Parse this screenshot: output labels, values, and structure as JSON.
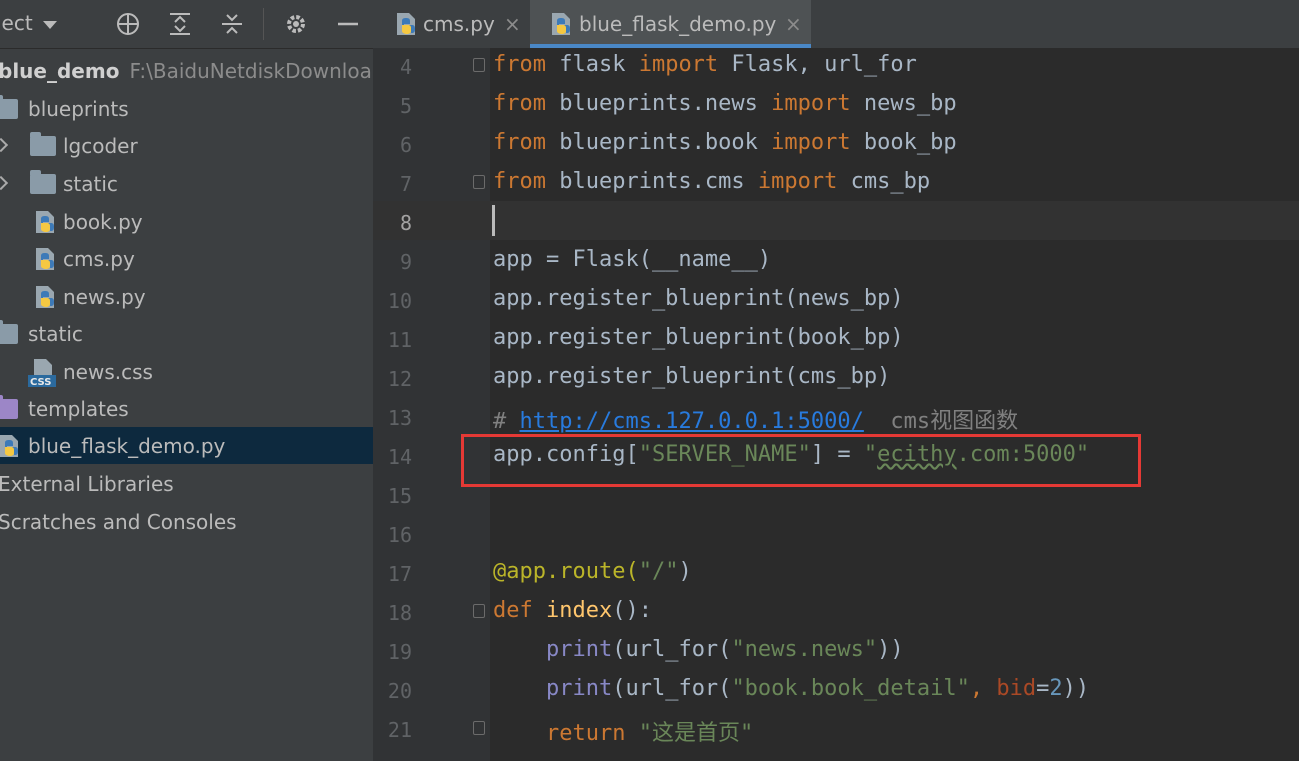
{
  "project_panel": {
    "title": "ject",
    "toolbar_icons": [
      "crosshair-icon",
      "expand-all-icon",
      "collapse-all-icon",
      "gear-icon",
      "minimize-icon"
    ],
    "tree": [
      {
        "label": "blue_demo",
        "path": "F:\\BaiduNetdiskDownloac",
        "type": "root"
      },
      {
        "label": "blueprints",
        "type": "folder"
      },
      {
        "label": "lgcoder",
        "type": "folder"
      },
      {
        "label": "static",
        "type": "folder"
      },
      {
        "label": "book.py",
        "type": "python"
      },
      {
        "label": "cms.py",
        "type": "python"
      },
      {
        "label": "news.py",
        "type": "python"
      },
      {
        "label": "static",
        "type": "folder"
      },
      {
        "label": "news.css",
        "type": "css"
      },
      {
        "label": "templates",
        "type": "folder-purple"
      },
      {
        "label": "blue_flask_demo.py",
        "type": "python",
        "selected": true
      },
      {
        "label": "External Libraries",
        "type": "library"
      },
      {
        "label": "Scratches and Consoles",
        "type": "scratch"
      }
    ],
    "css_badge": "CSS"
  },
  "tabs": [
    {
      "name": "cms.py",
      "close": "×",
      "active": false
    },
    {
      "name": "blue_flask_demo.py",
      "close": "×",
      "active": true
    }
  ],
  "editor": {
    "line_numbers": [
      "4",
      "5",
      "6",
      "7",
      "8",
      "9",
      "10",
      "11",
      "12",
      "13",
      "14",
      "15",
      "16",
      "17",
      "18",
      "19",
      "20",
      "21"
    ],
    "current_line": "8",
    "lines": {
      "l4": {
        "t1": "from",
        "t2": " flask ",
        "t3": "import",
        "t4": " Flask, url_for"
      },
      "l5": {
        "t1": "from",
        "t2": " blueprints.news ",
        "t3": "import",
        "t4": " news_bp"
      },
      "l6": {
        "t1": "from",
        "t2": " blueprints.book ",
        "t3": "import",
        "t4": " book_bp"
      },
      "l7": {
        "t1": "from",
        "t2": " blueprints.cms ",
        "t3": "import",
        "t4": " cms_bp"
      },
      "l9": {
        "t1": "app = Flask(__name__)"
      },
      "l10": {
        "t1": "app.register_blueprint(news_bp)"
      },
      "l11": {
        "t1": "app.register_blueprint(book_bp)"
      },
      "l12": {
        "t1": "app.register_blueprint(cms_bp)"
      },
      "l13": {
        "t1": "# ",
        "t2": "http://cms.127.0.0.1:5000/",
        "t3": "  cms视图函数"
      },
      "l14": {
        "t1": "app.config[",
        "t2": "\"SERVER_NAME\"",
        "t3": "] = ",
        "t4": "\"",
        "t5": "ecithy",
        "t6": ".com:5000\""
      },
      "l17": {
        "t1": "@app.route(",
        "t2": "\"/\"",
        "t3": ")"
      },
      "l18": {
        "t1": "def",
        "t2": " ",
        "t3": "index",
        "t4": "():"
      },
      "l19": {
        "t1": "    ",
        "t2": "print",
        "t3": "(url_for(",
        "t4": "\"news.news\"",
        "t5": "))"
      },
      "l20": {
        "t1": "    ",
        "t2": "print",
        "t3": "(url_for(",
        "t4": "\"book.book_detail\"",
        "t5": ", ",
        "t6": "bid",
        "t7": "=",
        "t8": "2",
        "t9": "))"
      },
      "l21": {
        "t1": "    ",
        "t2": "return",
        "t3": " ",
        "t4": "\"这是首页\""
      }
    }
  },
  "colors": {
    "keyword": "#cc7832",
    "string": "#6a8759",
    "function": "#ffc66d",
    "decorator": "#bbb529",
    "number": "#6897bb",
    "comment": "#808080",
    "highlight_box": "#e53935",
    "selection": "#0d293e"
  }
}
